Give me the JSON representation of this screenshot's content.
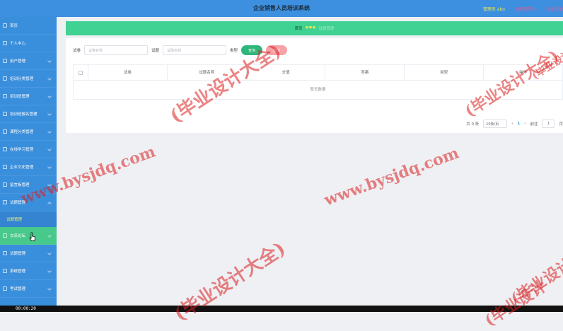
{
  "header": {
    "title": "企业销售人员培训系统",
    "admin_label": "管理员 abo",
    "link_front": "退出到前台",
    "link_logout": "退出登录"
  },
  "sidebar": {
    "items": [
      {
        "label": "首页"
      },
      {
        "label": "个人中心"
      },
      {
        "label": "用户管理"
      },
      {
        "label": "培训分类管理"
      },
      {
        "label": "培训班管理"
      },
      {
        "label": "培训班报名管理"
      },
      {
        "label": "课程分类管理"
      },
      {
        "label": "在线学习管理"
      },
      {
        "label": "企业文化管理"
      },
      {
        "label": "留言板管理"
      },
      {
        "label": "试题管理"
      },
      {
        "label": "交流论坛"
      },
      {
        "label": "试题管理"
      },
      {
        "label": "系统管理"
      },
      {
        "label": "考试管理"
      }
    ],
    "submenu_label": "试题管理"
  },
  "breadcrumb": {
    "home": "首页",
    "current": "♥♥♥",
    "sub": "试题管理"
  },
  "filters": {
    "label1": "试卷",
    "placeholder1": "试卷名称",
    "label2": "试题",
    "placeholder2": "试题名称",
    "label3": "类型",
    "search_btn": "查询",
    "delete_btn": "删除"
  },
  "table": {
    "headers": [
      "试卷",
      "试题名称",
      "分值",
      "答案",
      "类型",
      "操作"
    ],
    "empty_text": "暂无数据"
  },
  "pager": {
    "total": "共 0 条",
    "page_size": "10条/页",
    "prev": "‹",
    "current_page": "1",
    "next": "›",
    "goto_label": "前往",
    "goto_value": "1",
    "page_unit": "页"
  },
  "video": {
    "timestamp": "00:00:20"
  },
  "watermarks": {
    "a": "(毕业设计大全)",
    "b": "www.bysjdq.com",
    "c": "(毕业设计大全)",
    "d": "www.bysjdq.com",
    "e": "(毕业设计",
    "f": "(毕业设计大全)",
    "g": "(毕业设计",
    "h": "(毕业设计"
  },
  "colors": {
    "header": "#3d8fe0",
    "sidebar": "#3a8fdd",
    "breadcrumb": "#3fd293",
    "active_menu": "#46c98a",
    "watermark": "#dc1e1e"
  }
}
